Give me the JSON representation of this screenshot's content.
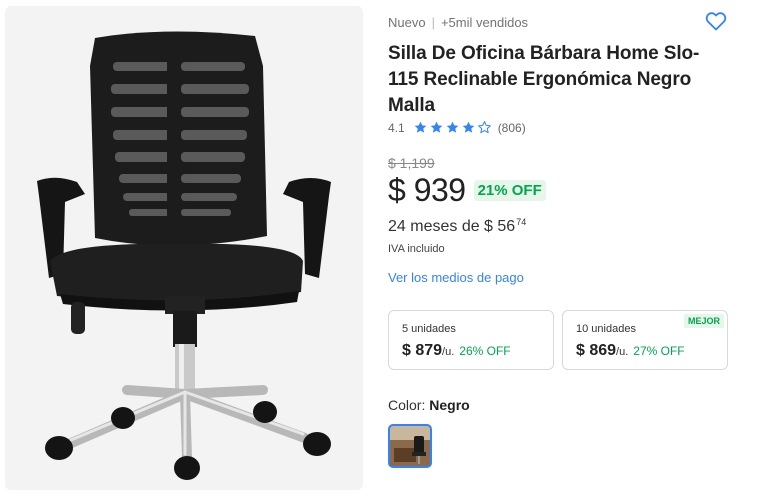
{
  "product": {
    "condition": "Nuevo",
    "separator": "|",
    "sold": "+5mil vendidos",
    "title": "Silla De Oficina Bárbara Home Slo-115 Reclinable Ergonómica Negro Malla",
    "rating": "4.1",
    "stars_filled": 4,
    "stars_total": 5,
    "review_count": "(806)"
  },
  "pricing": {
    "original": "$ 1,199",
    "current": "$ 939",
    "discount": "21% OFF",
    "installments_text": "24 meses de $ 56",
    "installments_cents": "74",
    "tax_note": "IVA incluido",
    "payment_link": "Ver los medios de pago"
  },
  "tiers": [
    {
      "units": "5 unidades",
      "price": "$ 879",
      "per_unit": "/u.",
      "discount": "26% OFF",
      "badge": ""
    },
    {
      "units": "10 unidades",
      "price": "$ 869",
      "per_unit": "/u.",
      "discount": "27% OFF",
      "badge": "MEJOR"
    }
  ],
  "variant": {
    "label": "Color:",
    "value": "Negro"
  },
  "icons": {
    "favorite": "heart-icon",
    "star": "star-icon"
  },
  "colors": {
    "accent": "#3483fa",
    "success": "#00a650",
    "success_bg": "#e6f7ea"
  }
}
